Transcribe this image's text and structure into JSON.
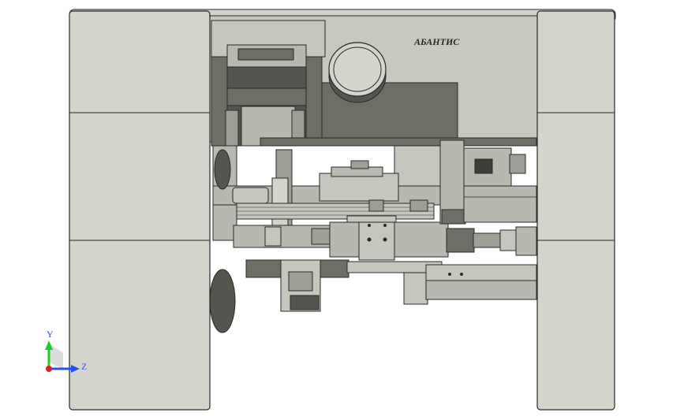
{
  "drawing": {
    "brand_label": "АБАНТИС",
    "colors": {
      "background": "#ffffff",
      "panel": "#d4d4cc",
      "panel_light": "#dcdcd4",
      "inner_frame": "#c8c8c0",
      "dark_block": "#6e6e66",
      "darker_block": "#55554f",
      "mid_part": "#b8b8b0",
      "light_part": "#c6c6be",
      "outline": "#2a2a26"
    }
  },
  "triad": {
    "y_label": "Y",
    "z_label": "Z",
    "y_color": "#22cc22",
    "z_color": "#2255ee",
    "x_color": "#dd2222"
  }
}
